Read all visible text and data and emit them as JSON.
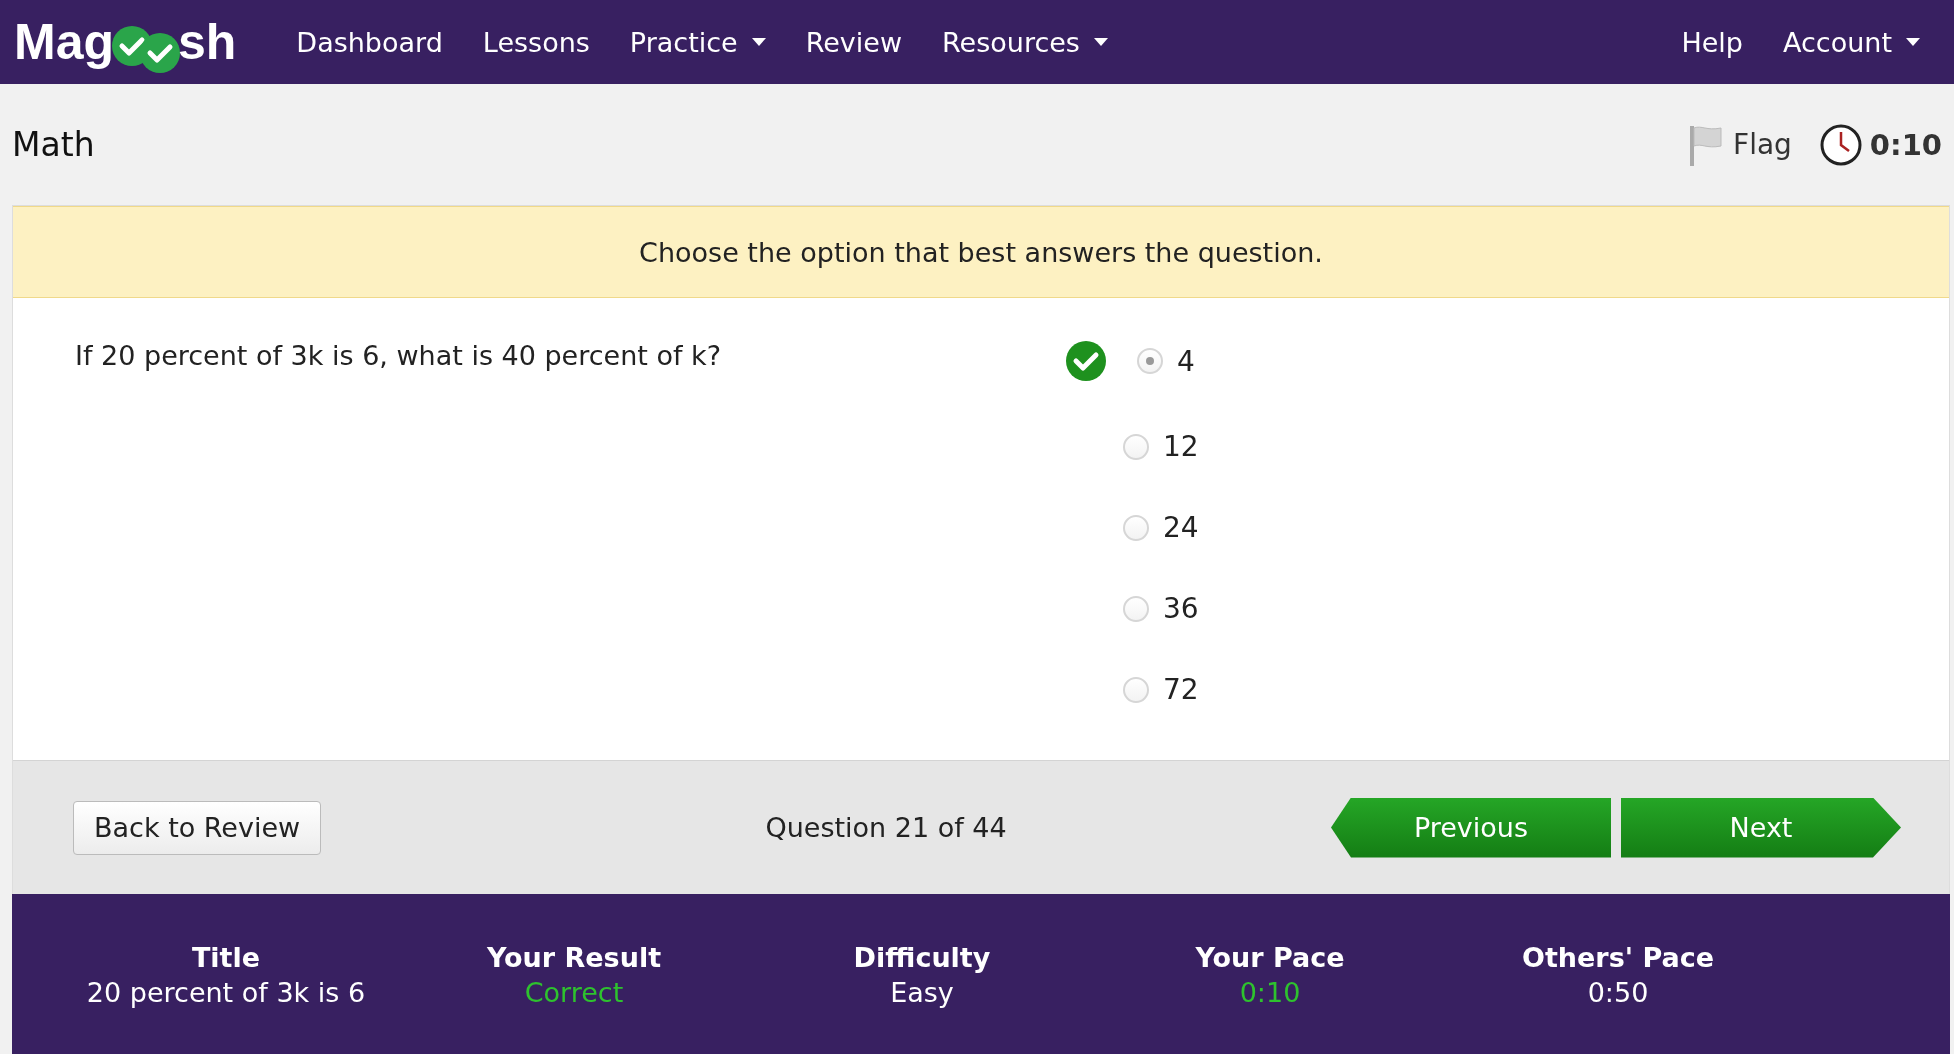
{
  "nav": {
    "logo": {
      "prefix": "Mag",
      "suffix": "sh"
    },
    "items": [
      {
        "label": "Dashboard",
        "dropdown": false
      },
      {
        "label": "Lessons",
        "dropdown": false
      },
      {
        "label": "Practice",
        "dropdown": true
      },
      {
        "label": "Review",
        "dropdown": false
      },
      {
        "label": "Resources",
        "dropdown": true
      }
    ],
    "right_items": [
      {
        "label": "Help",
        "dropdown": false
      },
      {
        "label": "Account",
        "dropdown": true
      }
    ]
  },
  "header": {
    "section": "Math",
    "flag": "Flag",
    "timer": "0:10"
  },
  "instruction": "Choose the option that best answers the question.",
  "question": "If 20 percent of 3k is 6, what is 40 percent of k?",
  "options": [
    {
      "label": "4",
      "selected": true,
      "correct": true
    },
    {
      "label": "12",
      "selected": false,
      "correct": false
    },
    {
      "label": "24",
      "selected": false,
      "correct": false
    },
    {
      "label": "36",
      "selected": false,
      "correct": false
    },
    {
      "label": "72",
      "selected": false,
      "correct": false
    }
  ],
  "footer": {
    "back": "Back to Review",
    "counter": "Question 21 of 44",
    "previous": "Previous",
    "next": "Next"
  },
  "stats": [
    {
      "label": "Title",
      "value": "20 percent of 3k is 6",
      "kind": "plain"
    },
    {
      "label": "Your Result",
      "value": "Correct",
      "kind": "good"
    },
    {
      "label": "Difficulty",
      "value": "Easy",
      "kind": "plain"
    },
    {
      "label": "Your Pace",
      "value": "0:10",
      "kind": "good"
    },
    {
      "label": "Others' Pace",
      "value": "0:50",
      "kind": "plain"
    }
  ]
}
